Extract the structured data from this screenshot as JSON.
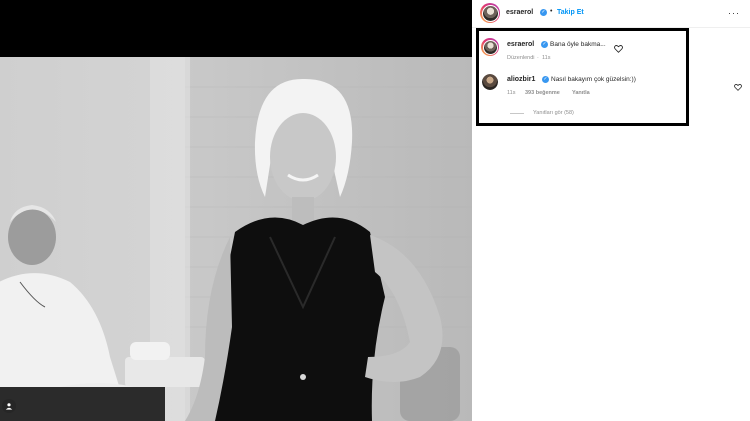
{
  "header": {
    "username": "esraerol",
    "separator": "•",
    "follow_label": "Takip Et",
    "more_label": "···"
  },
  "caption": {
    "username": "esraerol",
    "text": "Bana öyle bakma...",
    "edited_label": "Düzenlendi",
    "time": "11s",
    "heart_icon": "heart-outline-icon"
  },
  "reply": {
    "username": "aliozbir1",
    "text": "Nasıl bakayım çok güzelsin:))",
    "time": "11s",
    "likes": "393 beğenme",
    "reply_label": "Yanıtla",
    "view_replies": "Yanıtları gör (58)",
    "heart_icon": "heart-outline-icon"
  },
  "colors": {
    "link": "#0095f6",
    "verified": "#3897f0",
    "highlight": "#000000",
    "muted": "#8e8e8e"
  }
}
